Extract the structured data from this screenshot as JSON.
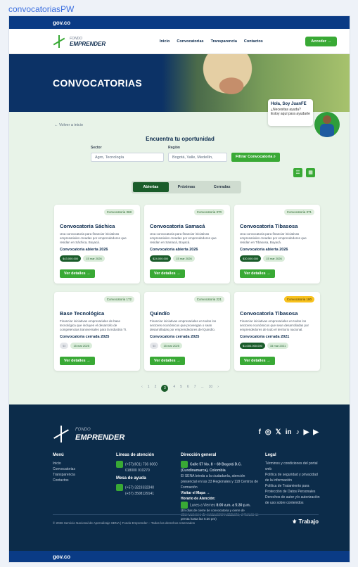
{
  "window_title": "convocatoriasPW",
  "gov_label": "gov.co",
  "brand": {
    "small": "FONDO",
    "name": "EMPRENDER"
  },
  "nav": {
    "items": [
      "Inicio",
      "Convocatorias",
      "Transparencia",
      "Contactos"
    ],
    "cta": "Acceder →"
  },
  "hero": {
    "title": "CONVOCATORIAS"
  },
  "assistant": {
    "greeting": "Hola, Soy JuanFE",
    "text": "¿Necesitas ayuda? Estoy aquí para ayudarte"
  },
  "back_link": "← Volver a inicio",
  "finder": {
    "title": "Encuentra tu oportunidad",
    "sector_label": "Sector",
    "sector_placeholder": "Agro, Tecnología",
    "region_label": "Región",
    "region_placeholder": "Bogotá, Valle, Medellín,",
    "filter_button": "Filtrar Convocatoria"
  },
  "tabs": [
    "Abiertas",
    "Próximas",
    "Cerradas"
  ],
  "cards": [
    {
      "badge": "Convocatoria 368",
      "title": "Convocatoria Sáchica",
      "desc": "Una convocatoria para financiar iniciativas empresariales creadas por emprendedores que residan en Sáchica, Boyacá.",
      "status": "Convocatoria abierta 2026",
      "pill1": "$43.000.000",
      "pill2": "15 mar 2026",
      "btn": "Ver detalles →"
    },
    {
      "badge": "Convocatoria 370",
      "title": "Convocatoria Samacá",
      "desc": "Una convocatoria para financiar iniciativas empresariales creadas por emprendedores que residan en Samacá, Boyacá.",
      "status": "Convocatoria abierta 2026",
      "pill1": "$24.000.000",
      "pill2": "15 mar 2026",
      "btn": "Ver detalles →"
    },
    {
      "badge": "Convocatoria 371",
      "title": "Convocatoria Tibasosa",
      "desc": "Una convocatoria para financiar iniciativas empresariales creadas por emprendedores que residan en Tibasosa, Boyacá.",
      "status": "Convocatoria abierta 2026",
      "pill1": "$30.000.000",
      "pill2": "15 mar 2026",
      "btn": "Ver detalles →"
    },
    {
      "badge": "Convocatoria 172",
      "title": "Base Tecnológica",
      "desc": "Financiar iniciativas empresariales de base tecnológica que incluyen el desarrollo de competencias transversales para la industria TI.",
      "status": "Convocatoria cerrada 2025",
      "pill1": "$0",
      "pill2": "15 mar 2025",
      "btn": "Ver detalles →"
    },
    {
      "badge": "Convocatoria 221",
      "title": "Quindío",
      "desc": "Financiar iniciativas empresariales en todos los sectores económicos que provengan o sean desarrolladas por emprendedores del Quindío.",
      "status": "Convocatoria cerrada 2025",
      "pill1": "$0",
      "pill2": "15 mar 2025",
      "btn": "Ver detalles →"
    },
    {
      "badge": "Convocatoria 180",
      "title": "Convocatoria Tibasosa",
      "desc": "Financiar iniciativas empresariales en todos los sectores económicos que sean desarrolladas por emprendedores de todo el territorio nacional.",
      "status": "Convocatoria cerrada 2021",
      "pill1": "$1.000.000.000",
      "pill2": "15 mar 2021",
      "btn": "Ver detalles →"
    }
  ],
  "pagination": [
    "‹",
    "1",
    "2",
    "3",
    "4",
    "5",
    "6",
    "7",
    "...",
    "10",
    "›"
  ],
  "footer": {
    "menu_title": "Menú",
    "menu": [
      "Inicio",
      "Convocatorias",
      "Transparencia",
      "Contactos"
    ],
    "lines_title": "Líneas de atención",
    "line1": "(+57)(601) 736 6060",
    "line2": "018000 910270",
    "support_title": "Mesa de ayuda",
    "support1": "(+57) 3223332340",
    "support2": "(+57) 3508129141",
    "dir_title": "Dirección general",
    "address": "Calle 57 No. 8 – 69 Bogotá D.C. (Cundinamarca), Colombia",
    "dir_text": "El SENA brinda a la ciudadanía, atención presencial en las 33 Regionales y 118 Centros de Formación",
    "map_link": "Visitar el Mapa →",
    "hours_title": "Horario de Atención:",
    "days": "Lunes a Viernes",
    "hours": "8:00 a.m. a 5:30 p.m.",
    "note": "(En días de cierre de convocatoria y cierre de observaciones de evaluación/revalidación, el horario se presta hasta las 6:30 pm)",
    "legal_title": "Legal",
    "legal": [
      "Términos y condiciones del portal web",
      "Política de seguridad y privacidad de la información",
      "Política de Tratamiento para Protección de Datos Personales",
      "Derechos de autor y/o autorización de uso sobre contenidos"
    ],
    "copyright": "© 2026 Servicio Nacional de Aprendizaje SENA | Fondo Emprender – Todos los derechos reservados",
    "trabajo": "Trabajo"
  }
}
